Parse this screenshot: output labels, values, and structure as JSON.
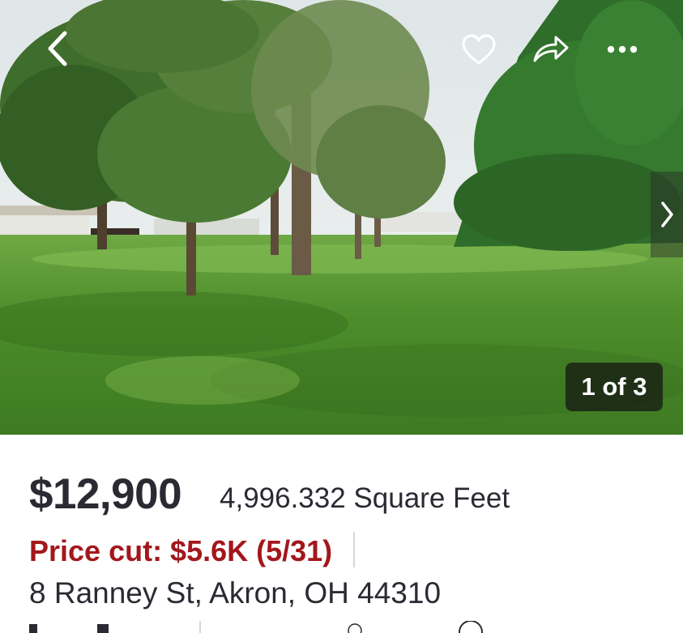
{
  "gallery": {
    "counter": "1 of 3",
    "icons": {
      "back": "chevron-left-icon",
      "favorite": "heart-icon",
      "share": "share-arrow-icon",
      "more": "more-horizontal-icon",
      "next": "chevron-right-icon"
    }
  },
  "listing": {
    "price": "$12,900",
    "size": "4,996.332 Square Feet",
    "price_cut": "Price cut: $5.6K (5/31)",
    "address": "8 Ranney St, Akron, OH 44310"
  },
  "colors": {
    "price_cut": "#a3171c",
    "text": "#2a2a33",
    "counter_bg": "#141414"
  }
}
